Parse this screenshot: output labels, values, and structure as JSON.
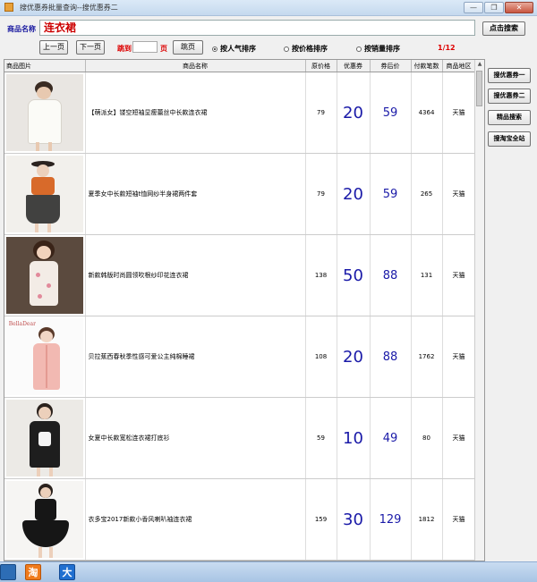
{
  "window": {
    "title": "搜优惠券批量查询--搜优惠券二",
    "minimize_glyph": "—",
    "restore_glyph": "❐",
    "close_glyph": "✕"
  },
  "search": {
    "label": "商品名称",
    "value": "连衣裙",
    "button": "点击搜索"
  },
  "pager": {
    "prev": "上一页",
    "next": "下一页",
    "jump_label": "跳到",
    "page_input": "",
    "page_unit": "页",
    "jump_button": "跳页",
    "indicator": "1/12"
  },
  "sort": {
    "options": [
      "按人气排序",
      "按价格排序",
      "按销量排序"
    ],
    "selected_index": 0
  },
  "table": {
    "headers": [
      "商品图片",
      "商品名称",
      "原价格",
      "优惠券",
      "券后价",
      "付款笔数",
      "商品地区"
    ],
    "rows": [
      {
        "image_icon": "white-lace-dress-photo",
        "name": "【萌派女】镂空短袖显瘦蕾丝中长款连衣裙",
        "price": "79",
        "coupon": "20",
        "after": "59",
        "sales": "4364",
        "region": "天猫"
      },
      {
        "image_icon": "black-mesh-skirt-photo",
        "name": "夏季女中长款短袖t恤网纱半身裙两件套",
        "price": "79",
        "coupon": "20",
        "after": "59",
        "sales": "265",
        "region": "天猫"
      },
      {
        "image_icon": "floral-dress-photo",
        "name": "新款韩版时尚圆领吹根纱印花连衣裙",
        "price": "138",
        "coupon": "50",
        "after": "88",
        "sales": "131",
        "region": "天猫"
      },
      {
        "image_icon": "pink-coat-dress-photo",
        "name": "贝拉蕉西春秋季性感可爱公主纯棉睡裙",
        "price": "108",
        "coupon": "20",
        "after": "88",
        "sales": "1762",
        "region": "天猫"
      },
      {
        "image_icon": "black-tshirt-dress-photo",
        "name": "女夏中长款宽松连衣裙打底衫",
        "price": "59",
        "coupon": "10",
        "after": "49",
        "sales": "80",
        "region": "天猫"
      },
      {
        "image_icon": "black-flared-dress-photo",
        "name": "衣多宝2017新款小香风喇叭袖连衣裙",
        "price": "159",
        "coupon": "30",
        "after": "129",
        "sales": "1812",
        "region": "天猫"
      }
    ]
  },
  "side_buttons": [
    "搜优惠券一",
    "搜优惠券二",
    "精品搜索",
    "搜淘宝全站"
  ],
  "taskbar": {
    "items": [
      {
        "icon": "app-icon",
        "glyph": ""
      },
      {
        "icon": "taobao-icon",
        "glyph": "淘"
      },
      {
        "icon": "da-icon",
        "glyph": "大"
      }
    ]
  },
  "colors": {
    "accent_blue": "#1a1aa8",
    "accent_red": "#d00000"
  }
}
